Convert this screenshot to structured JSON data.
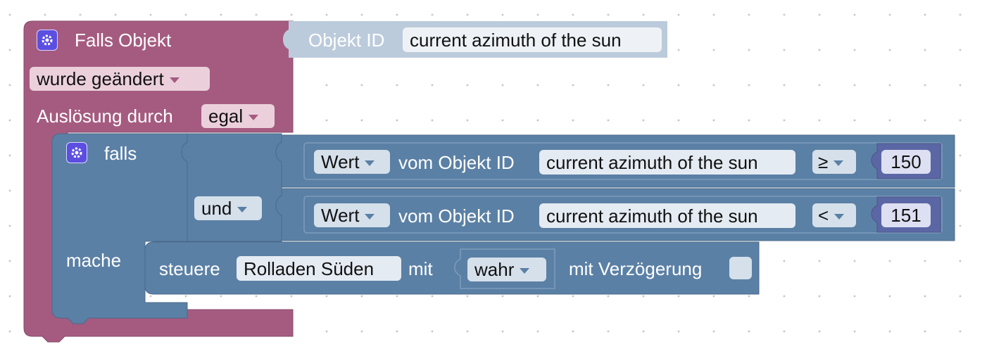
{
  "trigger_block": {
    "title": "Falls Objekt",
    "change_mode": "wurde geändert",
    "trigger_by_label": "Auslösung durch",
    "trigger_by_value": "egal",
    "object_id_label": "Objekt ID",
    "object_id_value": "current azimuth of the sun",
    "color": "#a55b80"
  },
  "if_block": {
    "if_label": "falls",
    "do_label": "mache",
    "logic_op": "und",
    "color": "#5b80a5",
    "conditions": [
      {
        "value_mode": "Wert",
        "from_label": "vom Objekt ID",
        "object_id": "current azimuth of the sun",
        "operator": "≥",
        "number": "150"
      },
      {
        "value_mode": "Wert",
        "from_label": "vom Objekt ID",
        "object_id": "current azimuth of the sun",
        "operator": "<",
        "number": "151"
      }
    ]
  },
  "control_block": {
    "control_label": "steuere",
    "target": "Rolladen Süden",
    "with_label": "mit",
    "value": "wahr",
    "delay_label": "mit Verzögerung"
  }
}
